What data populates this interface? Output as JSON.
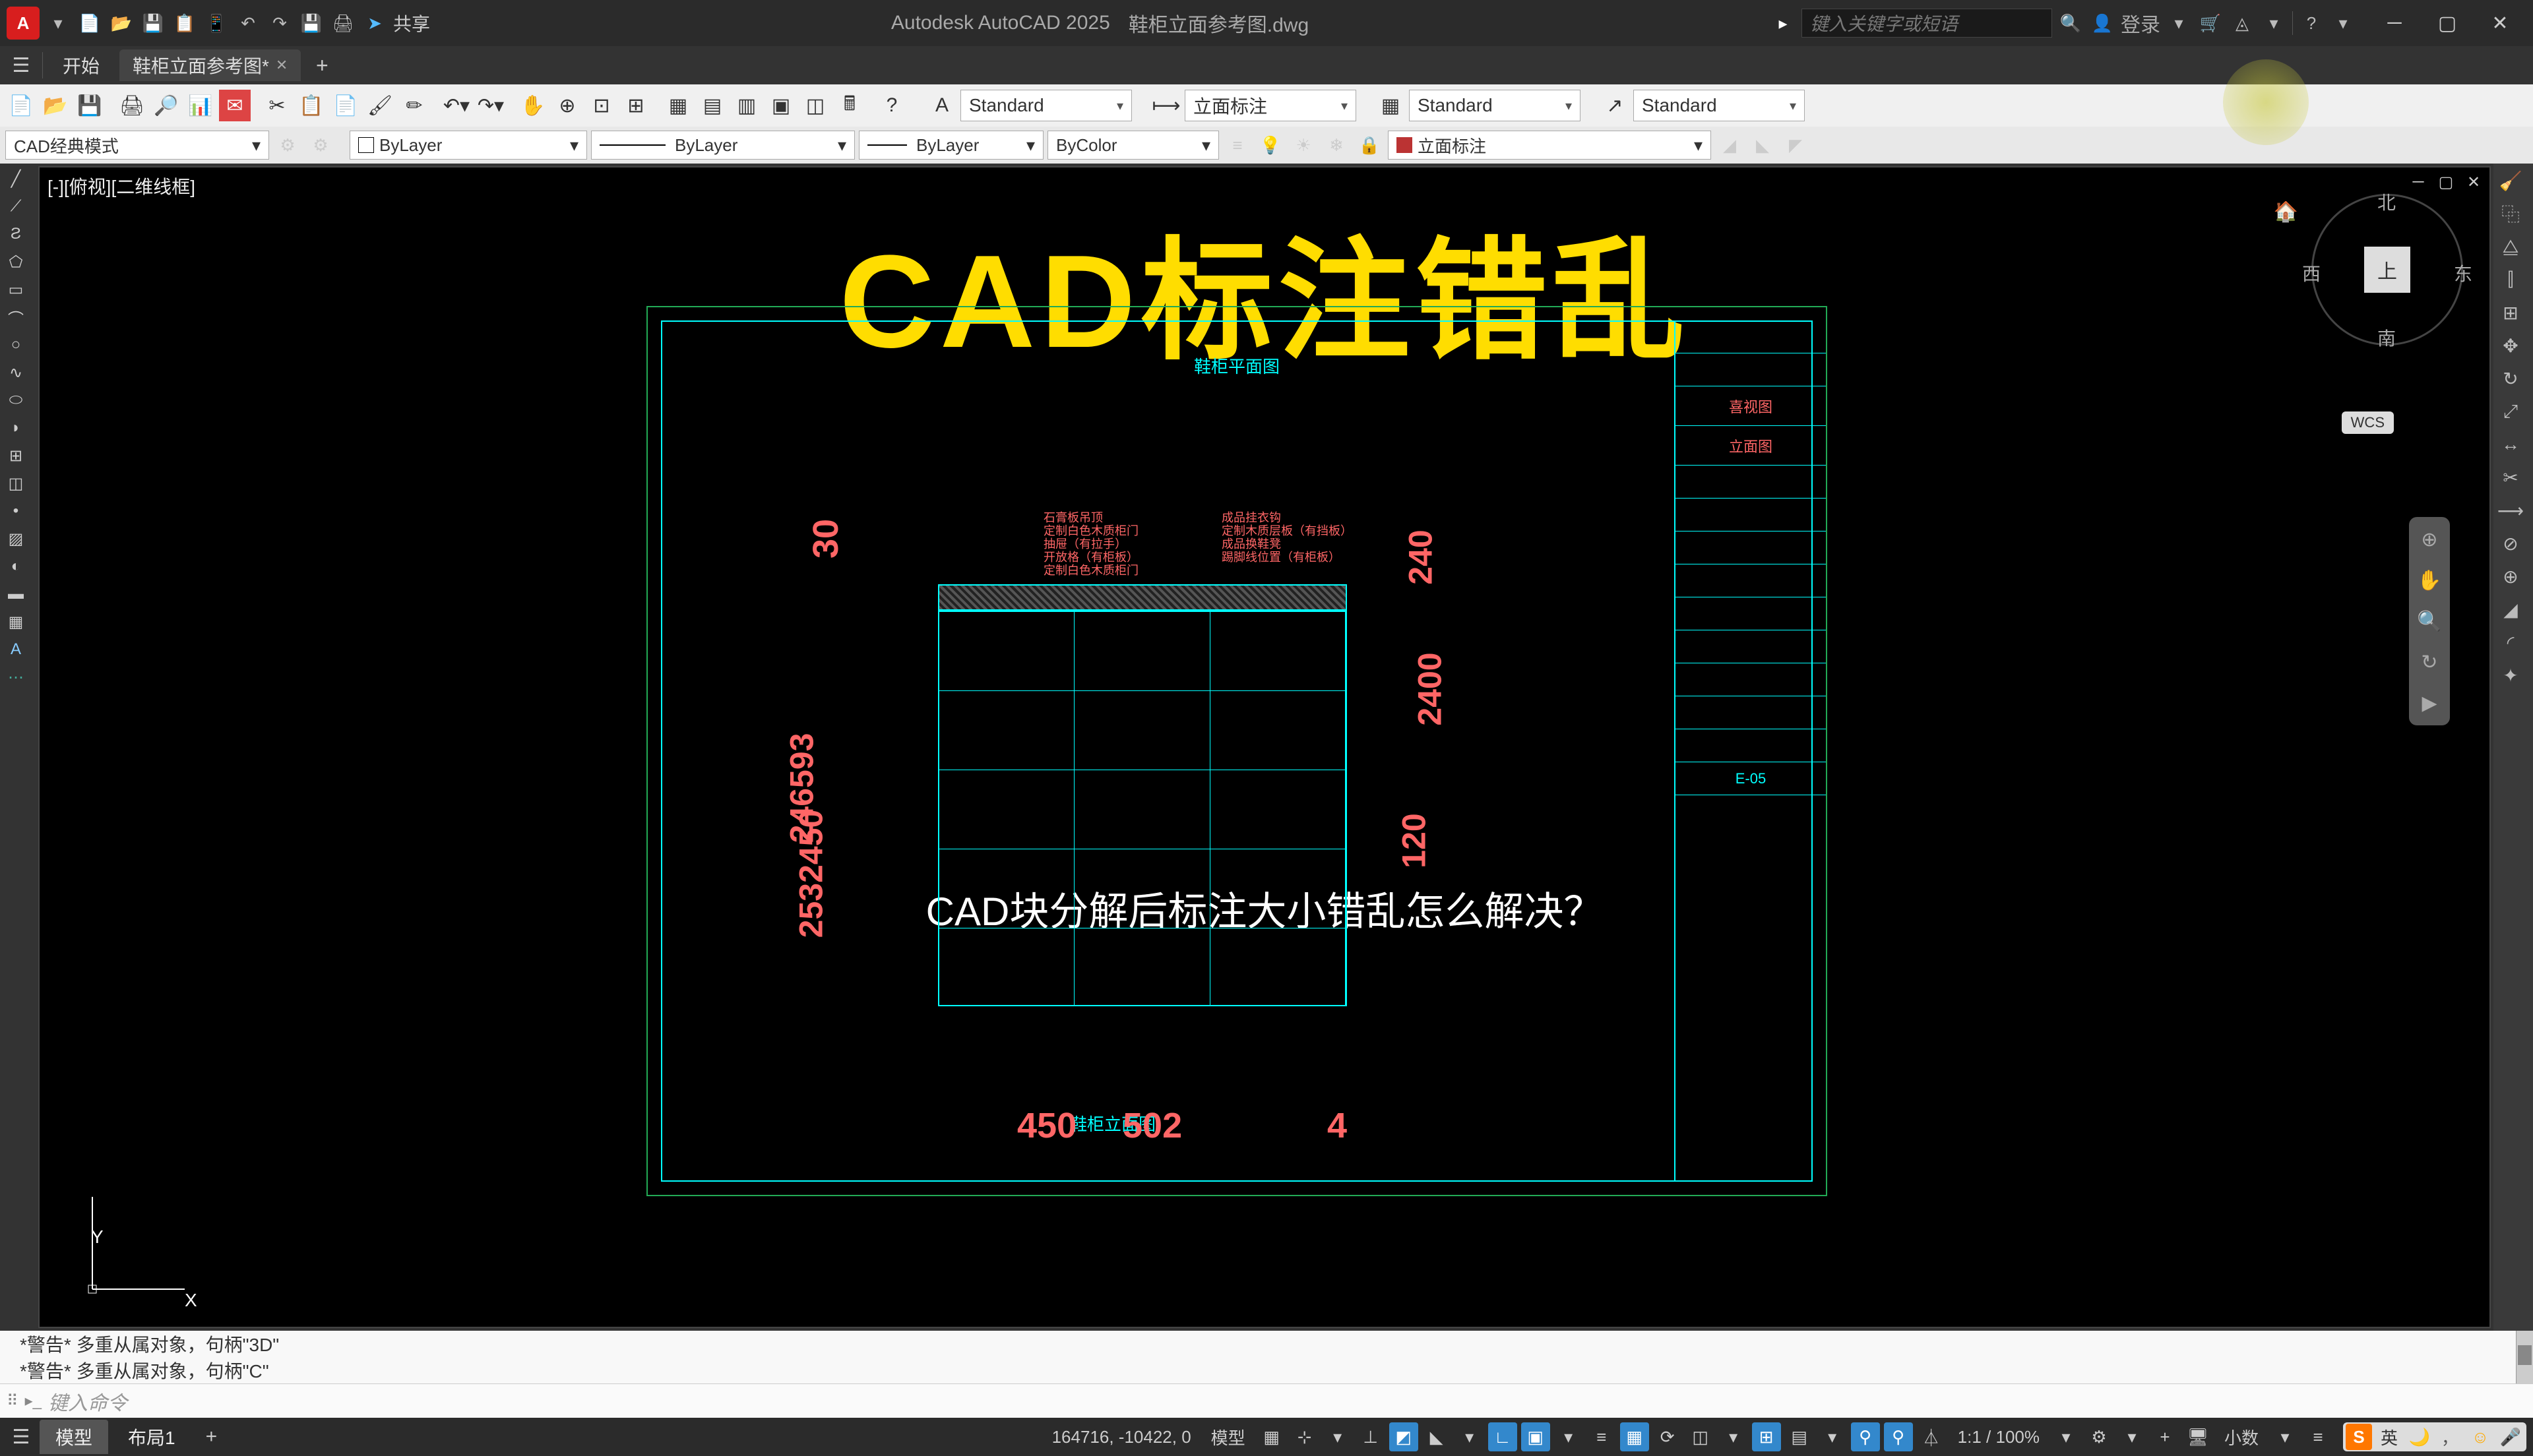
{
  "title": {
    "app": "Autodesk AutoCAD 2025",
    "file": "鞋柜立面参考图.dwg",
    "share": "共享",
    "login": "登录",
    "search_placeholder": "键入关键字或短语"
  },
  "tabs": {
    "start": "开始",
    "current": "鞋柜立面参考图*"
  },
  "toolbar": {
    "text_style": "Standard",
    "dim_style": "立面标注",
    "table_style": "Standard",
    "mleader_style": "Standard"
  },
  "properties": {
    "workspace": "CAD经典模式",
    "layer": "ByLayer",
    "linetype": "ByLayer",
    "lineweight": "ByLayer",
    "color": "ByColor",
    "layer_state": "立面标注"
  },
  "canvas": {
    "view_label": "[-][俯视][二维线框]",
    "overlay_title": "CAD标注错乱",
    "overlay_subtitle": "CAD块分解后标注大小错乱怎么解决？",
    "plan_title": "鞋柜平面图",
    "elevation_title": "鞋柜立面图",
    "title_block": {
      "row1": "喜视图",
      "row2": "立面图",
      "code": "E-05"
    },
    "annotations": {
      "a1": "石膏板吊顶",
      "a2": "定制白色木质柜门",
      "a3": "抽屉（有拉手）",
      "a4": "开放格（有柜板）",
      "a5": "定制白色木质柜门",
      "b1": "成品挂衣钩",
      "b2": "定制木质层板（有挡板）",
      "b3": "成品换鞋凳",
      "b4": "踢脚线位置（有柜板）"
    },
    "dims": {
      "d30": "30",
      "d240": "240",
      "d2400": "2400",
      "d450": "450",
      "d502": "502",
      "d4": "4",
      "overlap1": "246593",
      "overlap2": "2532450",
      "overlap3": "2430",
      "overlap4": "120"
    },
    "nav": {
      "n": "北",
      "s": "南",
      "e": "东",
      "w": "西",
      "top": "上",
      "wcs": "WCS"
    },
    "ucs": {
      "x": "X",
      "y": "Y"
    }
  },
  "command": {
    "history1": "*警告* 多重从属对象，句柄\"3D\"",
    "history2": "*警告* 多重从属对象，句柄\"C\"",
    "prompt": "键入命令"
  },
  "status": {
    "tab_model": "模型",
    "tab_layout": "布局1",
    "coords": "164716, -10422, 0",
    "space": "模型",
    "scale": "1:1 / 100%",
    "units": "小数"
  },
  "ime": {
    "lang": "英"
  }
}
